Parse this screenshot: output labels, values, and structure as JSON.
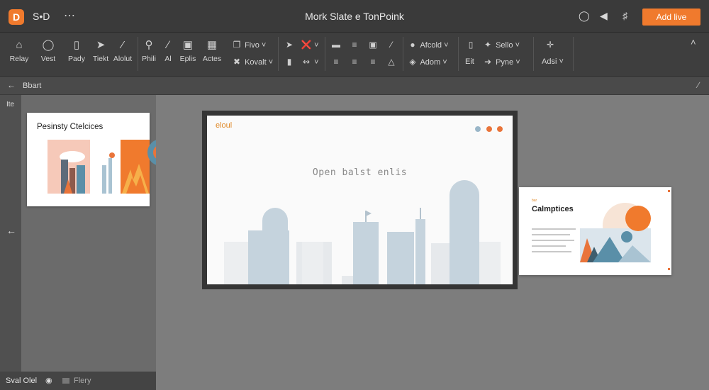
{
  "app": {
    "logo_text": "D",
    "name": "S•D",
    "more_icon": "more-dots-icon",
    "title": "Mork Slate e TonPoink",
    "add_button": "Add live",
    "accent": "#f07a2d",
    "titlebar_icons": [
      "info-circle-icon",
      "play-back-icon",
      "grid-hash-icon"
    ]
  },
  "ribbon": {
    "buttons": [
      {
        "name": "relay",
        "icon": "home-icon",
        "label": "Relay"
      },
      {
        "name": "vest",
        "icon": "shield-icon",
        "label": "Vest"
      },
      {
        "name": "pady",
        "icon": "columns-icon",
        "label": "Pady"
      },
      {
        "name": "tiekt",
        "icon": "cursor-icon",
        "label": "Tiekt"
      },
      {
        "name": "alolut",
        "icon": "pen-icon",
        "label": "Alolut"
      },
      {
        "name": "phili",
        "icon": "search-icon",
        "label": "Phili"
      },
      {
        "name": "ai",
        "icon": "wand-icon",
        "label": "Al"
      },
      {
        "name": "eplis",
        "icon": "comment-icon",
        "label": "Eplis"
      },
      {
        "name": "actes",
        "icon": "grid-icon",
        "label": "Actes"
      }
    ],
    "group_a": [
      {
        "name": "fivo",
        "icon": "crop-icon",
        "label": "Fivo"
      },
      {
        "name": "kovalt",
        "icon": "cross-icon",
        "label": "Kovalt"
      }
    ],
    "group_b": [
      {
        "name": "arrow",
        "icon": "arrow-icon",
        "label": ""
      },
      {
        "name": "shape",
        "icon": "shape-icon",
        "label": ""
      },
      {
        "name": "file",
        "icon": "file-icon",
        "label": ""
      },
      {
        "name": "magic",
        "icon": "magic-icon",
        "label": ""
      }
    ],
    "align_icons": [
      "align-left-icon",
      "align-center-icon",
      "frame-icon",
      "brush-icon",
      "align-top-icon",
      "align-middle-icon",
      "align-right-icon",
      "triangle-icon"
    ],
    "group_c": [
      {
        "name": "afcold",
        "icon": "person-icon",
        "label": "Afcold"
      },
      {
        "name": "adom",
        "icon": "people-icon",
        "label": "Adom"
      }
    ],
    "group_d": [
      {
        "name": "sello",
        "icon": "sparkle-icon",
        "label": "Sello"
      },
      {
        "name": "eit",
        "icon": "layout-icon",
        "label": "Eit"
      },
      {
        "name": "pyne",
        "icon": "tag-icon",
        "label": "Pyne"
      }
    ],
    "group_e": [
      {
        "name": "adjust",
        "icon": "move-icon",
        "label": ""
      },
      {
        "name": "adsi",
        "icon": "",
        "label": "Adsi"
      }
    ]
  },
  "subbar": {
    "breadcrumb": "Bbart"
  },
  "sidebar": {
    "rail_label": "Ite",
    "thumbnail_title": "Pesinsty Ctelcices",
    "colors": {
      "orange": "#f07a2d",
      "teal": "#5a8fa8"
    }
  },
  "status": {
    "text": "Sval Olel",
    "file": "Flery"
  },
  "canvas": {
    "main_slide": {
      "logo": "eloul",
      "placeholder": "Open balst enlis",
      "dot_colors": [
        "#9ab6c8",
        "#e9743a",
        "#e9743a"
      ]
    },
    "side_slide": {
      "tag": "bar",
      "title": "Calmptices"
    }
  }
}
